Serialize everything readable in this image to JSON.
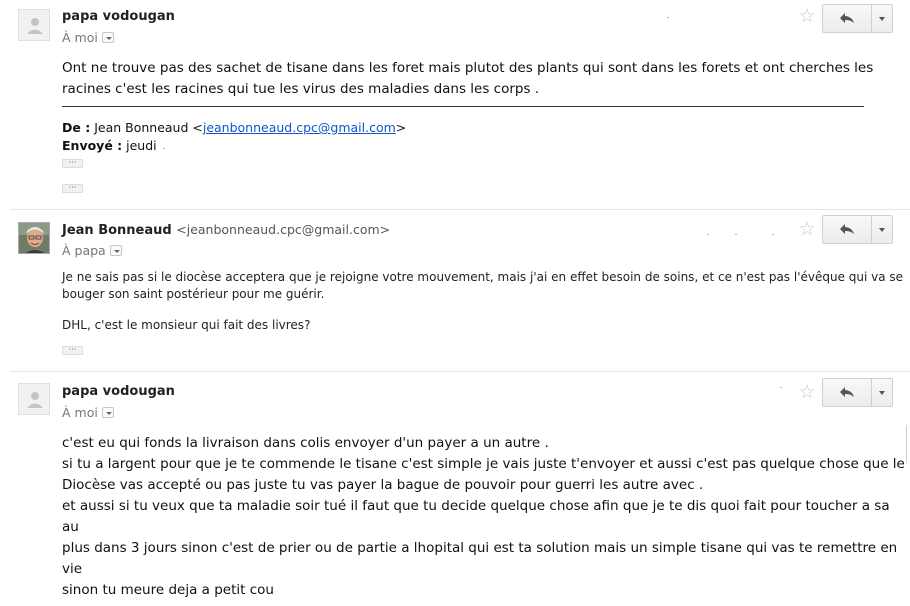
{
  "messages": [
    {
      "sender_name": "papa vodougan",
      "sender_email": "",
      "recipient": "À moi",
      "avatar": "person-silhouette-icon",
      "body": [
        "Ont ne trouve pas des sachet de tisane dans les foret mais plutot des plants qui sont dans les forets et ont cherches les",
        "racines c'est les racines qui tue les virus   des maladies dans les corps ."
      ],
      "quoted_header": {
        "from_label": "De :",
        "from_name": " Jean Bonneaud <",
        "from_email": "jeanbonneaud.cpc@gmail.com",
        "from_close": ">",
        "sent_label": "Envoyé :",
        "sent_value": " jeudi"
      },
      "ellipsis": "···"
    },
    {
      "sender_name": "Jean Bonneaud",
      "sender_email": "<jeanbonneaud.cpc@gmail.com>",
      "recipient": "À papa",
      "avatar": "user-photo",
      "body": [
        "Je ne sais pas si le diocèse acceptera que je rejoigne votre mouvement, mais j'ai en effet besoin de soins, et ce n'est pas l'évêque qui va se",
        "bouger son saint postérieur pour me guérir.",
        "DHL, c'est le monsieur qui fait des livres?"
      ],
      "ellipsis": "···"
    },
    {
      "sender_name": "papa vodougan",
      "sender_email": "",
      "recipient": "À moi",
      "avatar": "person-silhouette-icon",
      "body": [
        "c'est eu qui fonds la livraison dans colis envoyer d'un payer a un autre .",
        "si tu a largent pour que je te commende le tisane c'est simple je vais juste t'envoyer et aussi  c'est pas quelque chose que le",
        "Diocèse vas accepté ou pas juste tu vas payer la bague de pouvoir pour guerri les autre avec .",
        "et aussi si tu veux que ta maladie soir tué il faut que tu decide quelque chose afin que je te dis quoi fait pour toucher a sa  au",
        "plus dans 3 jours sinon c'est de prier ou de partie a lhopital qui est ta solution mais un simple tisane qui vas te remettre en vie",
        "sinon tu meure deja a petit cou"
      ]
    }
  ],
  "icons": {
    "star": "star-icon",
    "reply": "reply-arrow-icon",
    "more": "chevron-down-icon",
    "recipient_details": "chevron-down-icon"
  },
  "colors": {
    "link": "#1155cc",
    "star": "#c8c8c8",
    "divider": "#e5e5e5"
  }
}
